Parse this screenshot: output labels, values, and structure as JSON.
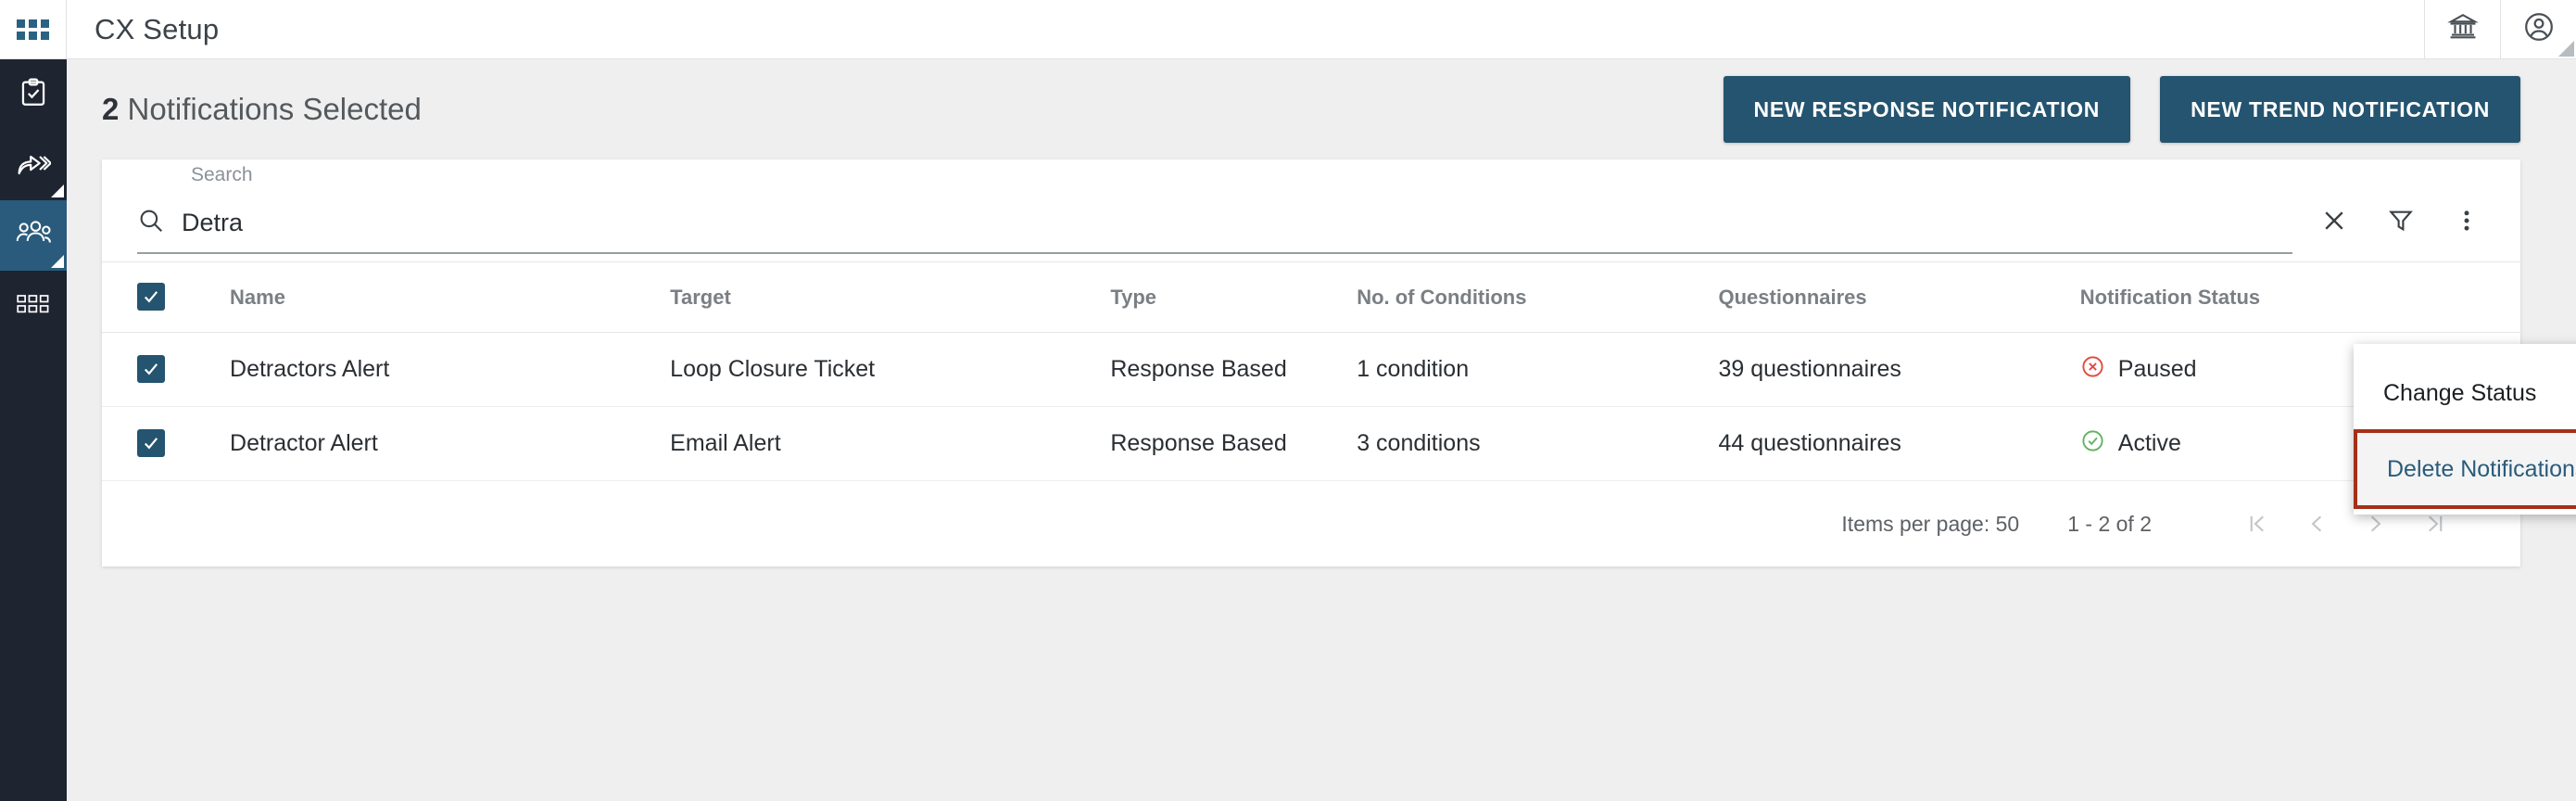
{
  "topbar": {
    "waffle_icon": "apps-grid-icon",
    "title": "CX Setup",
    "right_icons": [
      {
        "name": "bank-institution-icon"
      },
      {
        "name": "account-circle-icon"
      }
    ]
  },
  "rail": {
    "items": [
      {
        "name": "sidebar-item-surveys",
        "icon": "clipboard-check-icon",
        "active": false,
        "has_corner": false
      },
      {
        "name": "sidebar-item-share",
        "icon": "share-forward-icon",
        "active": false,
        "has_corner": true
      },
      {
        "name": "sidebar-item-audience",
        "icon": "people-group-icon",
        "active": true,
        "has_corner": true
      },
      {
        "name": "sidebar-item-dashboard",
        "icon": "grid-modules-icon",
        "active": false,
        "has_corner": false
      }
    ]
  },
  "page": {
    "selected_count": "2",
    "title_suffix": "Notifications Selected",
    "buttons": {
      "new_response": "NEW RESPONSE NOTIFICATION",
      "new_trend": "NEW TREND NOTIFICATION"
    },
    "accent_color": "#24546f"
  },
  "search": {
    "label": "Search",
    "value": "Detra",
    "placeholder": "Search",
    "icons": {
      "search": "search-icon",
      "clear": "close-x-icon",
      "filter": "filter-funnel-icon",
      "more": "more-vertical-icon"
    }
  },
  "menu": {
    "items": [
      {
        "label": "Change Status",
        "has_submenu": true,
        "highlighted": false
      },
      {
        "label": "Delete Notifications",
        "has_submenu": false,
        "highlighted": true
      }
    ],
    "highlight_border_color": "#a53018",
    "highlight_text_color": "#2a5b7c"
  },
  "table": {
    "columns": [
      "Name",
      "Target",
      "Type",
      "No. of Conditions",
      "Questionnaires",
      "Notification Status"
    ],
    "header_checkbox_checked": true,
    "rows": [
      {
        "checked": true,
        "name": "Detractors Alert",
        "target": "Loop Closure Ticket",
        "type": "Response Based",
        "conditions": "1 condition",
        "questionnaires": "39 questionnaires",
        "status": "Paused",
        "status_icon": "circle-x-icon",
        "status_color": "#e34b3f"
      },
      {
        "checked": true,
        "name": "Detractor Alert",
        "target": "Email Alert",
        "type": "Response Based",
        "conditions": "3 conditions",
        "questionnaires": "44 questionnaires",
        "status": "Active",
        "status_icon": "circle-check-icon",
        "status_color": "#64b264"
      }
    ],
    "footer": {
      "items_per_page": "Items per page: 50",
      "range": "1 - 2 of 2",
      "pagination": [
        {
          "name": "first-page-button",
          "glyph": "|<"
        },
        {
          "name": "previous-page-button",
          "glyph": "<"
        },
        {
          "name": "next-page-button",
          "glyph": ">"
        },
        {
          "name": "last-page-button",
          "glyph": ">|"
        }
      ]
    }
  }
}
